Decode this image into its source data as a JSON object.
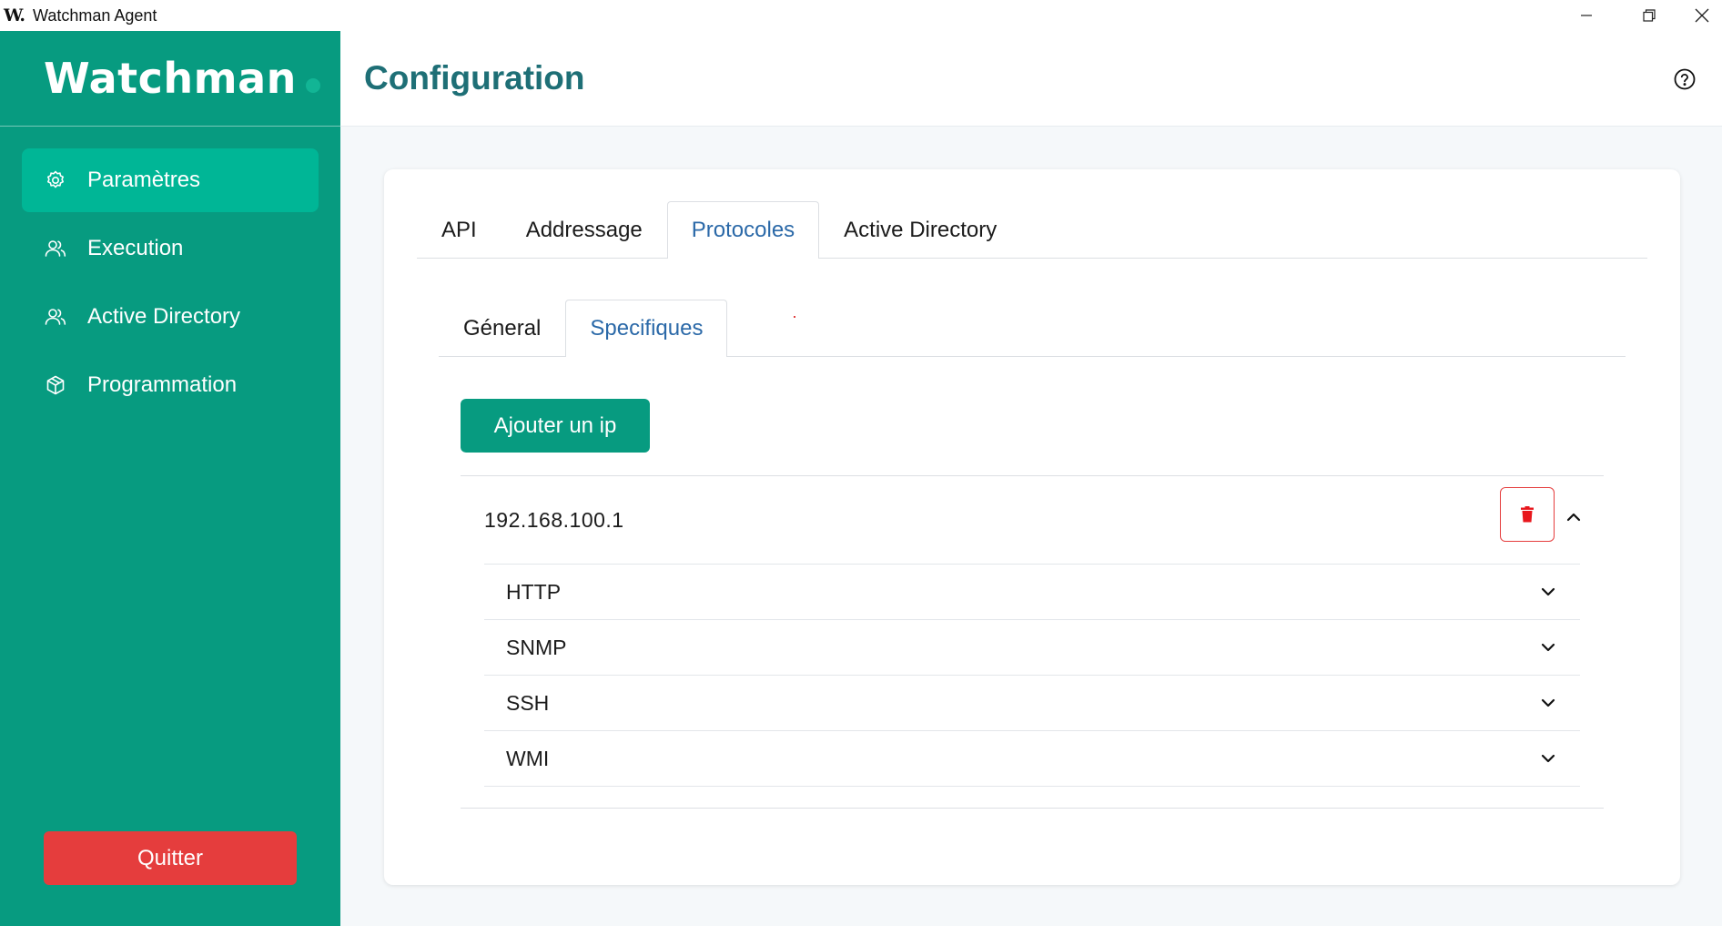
{
  "window": {
    "icon_text": "W.",
    "title": "Watchman Agent"
  },
  "sidebar": {
    "logo": "Watchman",
    "items": [
      {
        "label": "Paramètres",
        "icon": "gear-icon",
        "active": true
      },
      {
        "label": "Execution",
        "icon": "users-icon",
        "active": false
      },
      {
        "label": "Active Directory",
        "icon": "users-icon",
        "active": false
      },
      {
        "label": "Programmation",
        "icon": "cube-icon",
        "active": false
      }
    ],
    "quit_label": "Quitter"
  },
  "header": {
    "title": "Configuration",
    "help_icon": "help-circle-icon"
  },
  "main_tabs": [
    {
      "label": "API",
      "active": false
    },
    {
      "label": "Addressage",
      "active": false
    },
    {
      "label": "Protocoles",
      "active": true
    },
    {
      "label": "Active Directory",
      "active": false
    }
  ],
  "sub_tabs": [
    {
      "label": "Géneral",
      "active": false
    },
    {
      "label": "Specifiques",
      "active": true
    }
  ],
  "add_ip_label": "Ajouter un ip",
  "ip_entry": {
    "address": "192.168.100.1",
    "expanded": true,
    "protocols": [
      "HTTP",
      "SNMP",
      "SSH",
      "WMI"
    ]
  },
  "colors": {
    "brand": "#079b80",
    "brand_active": "#00b696",
    "danger": "#e53d3d",
    "title": "#1e6f76",
    "tab_active": "#2b69a8"
  }
}
